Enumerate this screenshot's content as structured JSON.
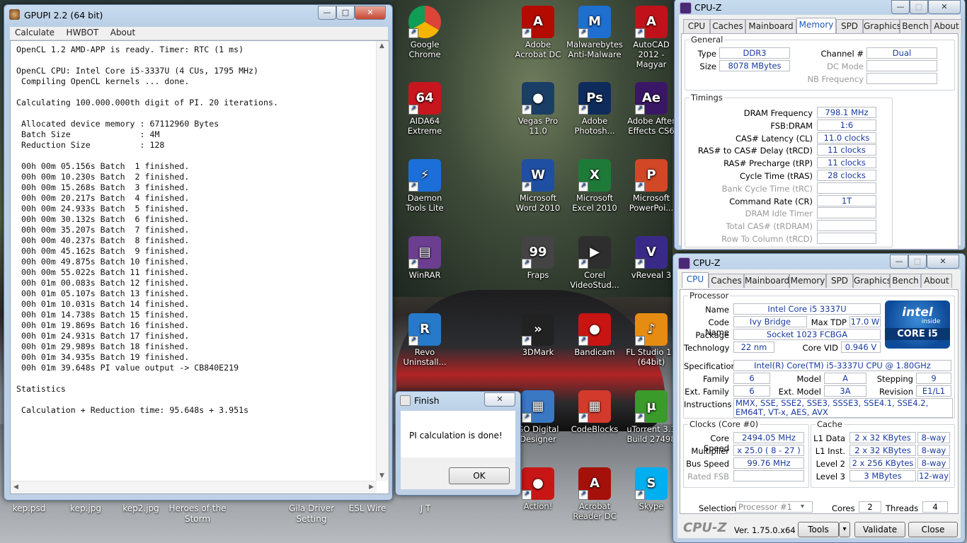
{
  "desktop": {
    "icons": [
      {
        "label": "Google Chrome",
        "glyph": "",
        "color": "#e8e8e8"
      },
      {
        "label": "Adobe Acrobat DC",
        "glyph": "A",
        "color": "#b30b00"
      },
      {
        "label": "Malwarebytes Anti-Malware",
        "glyph": "M",
        "color": "#1e6fd0"
      },
      {
        "label": "AutoCAD 2012 - Magyar",
        "glyph": "A",
        "color": "#c1121c"
      },
      {
        "label": "AIDA64 Extreme",
        "glyph": "64",
        "color": "#c7161d"
      },
      {
        "label": "Vegas Pro 11.0",
        "glyph": "●",
        "color": "#1b3e66"
      },
      {
        "label": "Adobe Photosh...",
        "glyph": "Ps",
        "color": "#0f2b5b"
      },
      {
        "label": "Adobe After Effects CS6",
        "glyph": "Ae",
        "color": "#3a1766"
      },
      {
        "label": "Daemon Tools Lite",
        "glyph": "⚡",
        "color": "#1c6fd8"
      },
      {
        "label": "Microsoft Word 2010",
        "glyph": "W",
        "color": "#1f4fa3"
      },
      {
        "label": "Microsoft Excel 2010",
        "glyph": "X",
        "color": "#1e7a38"
      },
      {
        "label": "Microsoft PowerPoi...",
        "glyph": "P",
        "color": "#d24726"
      },
      {
        "label": "WinRAR",
        "glyph": "▤",
        "color": "#6b3e8f"
      },
      {
        "label": "Fraps",
        "glyph": "99",
        "color": "#444"
      },
      {
        "label": "Corel VideoStud...",
        "glyph": "▶",
        "color": "#2e2e2e"
      },
      {
        "label": "vReveal 3",
        "glyph": "V",
        "color": "#3a2a88"
      },
      {
        "label": "Revo Uninstall...",
        "glyph": "R",
        "color": "#2779c9"
      },
      {
        "label": "3DMark",
        "glyph": "»",
        "color": "#222"
      },
      {
        "label": "Bandicam",
        "glyph": "●",
        "color": "#c91414"
      },
      {
        "label": "FL Studio 11 (64bit)",
        "glyph": "♪",
        "color": "#e78c12"
      },
      {
        "label": "GO Digital Designer",
        "glyph": "▦",
        "color": "#3b78c4"
      },
      {
        "label": "CodeBlocks",
        "glyph": "▦",
        "color": "#d33a2c"
      },
      {
        "label": "uTorrent 3.1 Build 27498",
        "glyph": "µ",
        "color": "#3a9b2a"
      },
      {
        "label": "Action!",
        "glyph": "●",
        "color": "#c81616"
      },
      {
        "label": "Acrobat Reader DC",
        "glyph": "A",
        "color": "#a5110a"
      },
      {
        "label": "Skype",
        "glyph": "S",
        "color": "#00aff0"
      }
    ],
    "files": [
      "kep.psd",
      "kep.jpg",
      "kep2.jpg",
      "Heroes of the Storm",
      "Gila Driver Setting",
      "ESL Wire",
      "J T"
    ]
  },
  "gpupi": {
    "title": "GPUPI 2.2 (64 bit)",
    "menu": [
      "Calculate",
      "HWBOT",
      "About"
    ],
    "log": "OpenCL 1.2 AMD-APP is ready. Timer: RTC (1 ms)\n\nOpenCL CPU: Intel Core i5-3337U (4 CUs, 1795 MHz)\n Compiling OpenCL kernels ... done.\n\nCalculating 100.000.000th digit of PI. 20 iterations.\n\n Allocated device memory : 67112960 Bytes\n Batch Size              : 4M\n Reduction Size          : 128\n\n 00h 00m 05.156s Batch  1 finished.\n 00h 00m 10.230s Batch  2 finished.\n 00h 00m 15.268s Batch  3 finished.\n 00h 00m 20.217s Batch  4 finished.\n 00h 00m 24.933s Batch  5 finished.\n 00h 00m 30.132s Batch  6 finished.\n 00h 00m 35.207s Batch  7 finished.\n 00h 00m 40.237s Batch  8 finished.\n 00h 00m 45.162s Batch  9 finished.\n 00h 00m 49.875s Batch 10 finished.\n 00h 00m 55.022s Batch 11 finished.\n 00h 01m 00.083s Batch 12 finished.\n 00h 01m 05.107s Batch 13 finished.\n 00h 01m 10.031s Batch 14 finished.\n 00h 01m 14.738s Batch 15 finished.\n 00h 01m 19.869s Batch 16 finished.\n 00h 01m 24.931s Batch 17 finished.\n 00h 01m 29.989s Batch 18 finished.\n 00h 01m 34.935s Batch 19 finished.\n 00h 01m 39.648s PI value output -> CB840E219\n\nStatistics\n\n Calculation + Reduction time: 95.648s + 3.951s"
  },
  "finish": {
    "title": "Finish",
    "message": "PI calculation is done!",
    "ok": "OK",
    "close": "✕"
  },
  "window_buttons": {
    "min": "—",
    "max": "□",
    "close": "✕"
  },
  "cpuz_memory": {
    "title": "CPU-Z",
    "tabs": [
      "CPU",
      "Caches",
      "Mainboard",
      "Memory",
      "SPD",
      "Graphics",
      "Bench",
      "About"
    ],
    "active_tab": "Memory",
    "general_label": "General",
    "type_label": "Type",
    "type": "DDR3",
    "size_label": "Size",
    "size": "8078 MBytes",
    "channel_label": "Channel #",
    "channel": "Dual",
    "dc_label": "DC Mode",
    "dc": "",
    "nb_label": "NB Frequency",
    "nb": "",
    "timings_label": "Timings",
    "timings": [
      {
        "label": "DRAM Frequency",
        "value": "798.1 MHz",
        "dis": false
      },
      {
        "label": "FSB:DRAM",
        "value": "1:6",
        "dis": false
      },
      {
        "label": "CAS# Latency (CL)",
        "value": "11.0 clocks",
        "dis": false
      },
      {
        "label": "RAS# to CAS# Delay (tRCD)",
        "value": "11 clocks",
        "dis": false
      },
      {
        "label": "RAS# Precharge (tRP)",
        "value": "11 clocks",
        "dis": false
      },
      {
        "label": "Cycle Time (tRAS)",
        "value": "28 clocks",
        "dis": false
      },
      {
        "label": "Bank Cycle Time (tRC)",
        "value": "",
        "dis": true
      },
      {
        "label": "Command Rate (CR)",
        "value": "1T",
        "dis": false
      },
      {
        "label": "DRAM Idle Timer",
        "value": "",
        "dis": true
      },
      {
        "label": "Total CAS# (tRDRAM)",
        "value": "",
        "dis": true
      },
      {
        "label": "Row To Column (tRCD)",
        "value": "",
        "dis": true
      }
    ]
  },
  "cpuz_cpu": {
    "title": "CPU-Z",
    "tabs": [
      "CPU",
      "Caches",
      "Mainboard",
      "Memory",
      "SPD",
      "Graphics",
      "Bench",
      "About"
    ],
    "active_tab": "CPU",
    "processor_label": "Processor",
    "name_label": "Name",
    "name": "Intel Core i5 3337U",
    "codename_label": "Code Name",
    "codename": "Ivy Bridge",
    "maxtdp_label": "Max TDP",
    "maxtdp": "17.0 W",
    "package_label": "Package",
    "package": "Socket 1023 FCBGA",
    "tech_label": "Technology",
    "tech": "22 nm",
    "vid_label": "Core VID",
    "vid": "0.946 V",
    "spec_label": "Specification",
    "spec": "Intel(R) Core(TM) i5-3337U CPU @ 1.80GHz",
    "family_label": "Family",
    "family": "6",
    "model_label": "Model",
    "model": "A",
    "stepping_label": "Stepping",
    "stepping": "9",
    "extfamily_label": "Ext. Family",
    "extfamily": "6",
    "extmodel_label": "Ext. Model",
    "extmodel": "3A",
    "revision_label": "Revision",
    "revision": "E1/L1",
    "instr_label": "Instructions",
    "instr": "MMX, SSE, SSE2, SSE3, SSSE3, SSE4.1, SSE4.2, EM64T, VT-x, AES, AVX",
    "logo_top": "intel",
    "logo_inside": "inside",
    "logo_bottom": "CORE i5",
    "clocks_label": "Clocks (Core #0)",
    "corespeed_label": "Core Speed",
    "corespeed": "2494.05 MHz",
    "multiplier_label": "Multiplier",
    "multiplier": "x 25.0 ( 8 - 27 )",
    "busspeed_label": "Bus Speed",
    "busspeed": "99.76 MHz",
    "ratedfsb_label": "Rated FSB",
    "ratedfsb": "",
    "cache_label": "Cache",
    "cache": [
      {
        "label": "L1 Data",
        "size": "2 x 32 KBytes",
        "way": "8-way"
      },
      {
        "label": "L1 Inst.",
        "size": "2 x 32 KBytes",
        "way": "8-way"
      },
      {
        "label": "Level 2",
        "size": "2 x 256 KBytes",
        "way": "8-way"
      },
      {
        "label": "Level 3",
        "size": "3 MBytes",
        "way": "12-way"
      }
    ],
    "selection_label": "Selection",
    "selection": "Processor #1",
    "cores_label": "Cores",
    "cores": "2",
    "threads_label": "Threads",
    "threads": "4",
    "brand": "CPU-Z",
    "version": "Ver. 1.75.0.x64",
    "tools": "Tools",
    "tools_arrow": "▾",
    "validate": "Validate",
    "close": "Close"
  }
}
